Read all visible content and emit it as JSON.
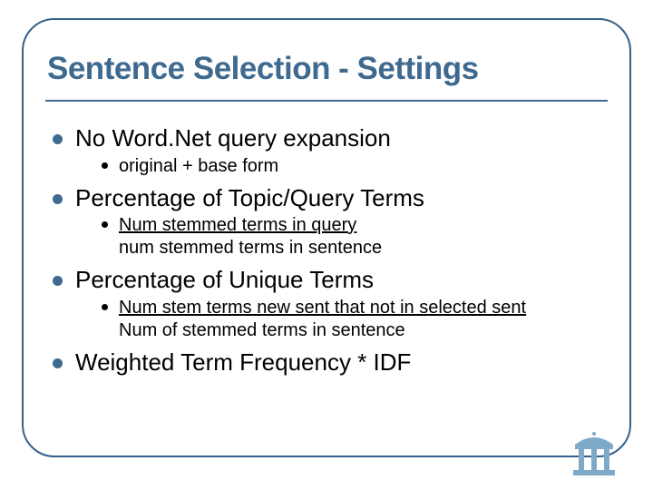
{
  "title": "Sentence Selection - Settings",
  "items": [
    {
      "text": "No Word.Net query expansion",
      "sub": [
        {
          "line1": "original + base form",
          "line2": "",
          "underline": false
        }
      ]
    },
    {
      "text": "Percentage of Topic/Query Terms",
      "sub": [
        {
          "line1": "Num stemmed terms in query",
          "line2": "num stemmed terms in sentence",
          "underline": true
        }
      ]
    },
    {
      "text": "Percentage of Unique Terms",
      "sub": [
        {
          "line1": "Num stem terms new sent that not in selected sent",
          "line2": "Num of stemmed terms in sentence",
          "underline": true
        }
      ]
    },
    {
      "text": "Weighted Term Frequency * IDF",
      "sub": []
    }
  ],
  "logo_name": "unc-old-well-logo",
  "colors": {
    "accent": "#3f6a8f"
  }
}
